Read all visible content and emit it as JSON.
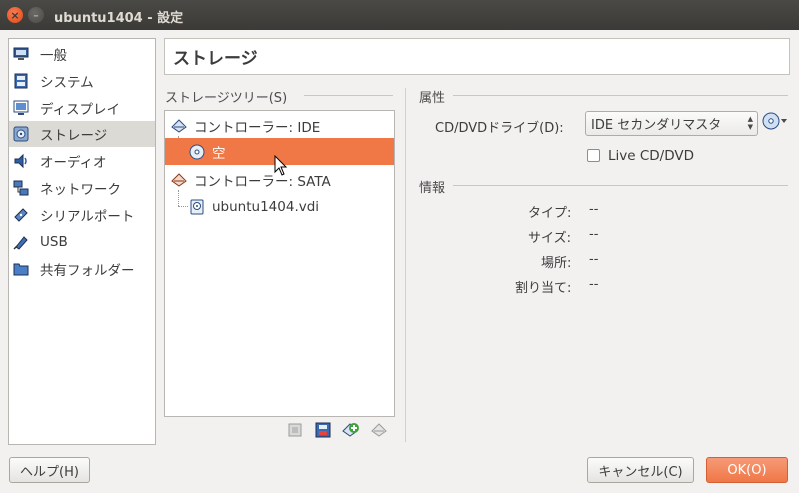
{
  "window": {
    "title": "ubuntu1404 - 設定",
    "close_glyph": "×",
    "min_glyph": "–"
  },
  "sidebar": {
    "items": [
      {
        "label": "一般",
        "icon": "general-monitor-icon"
      },
      {
        "label": "システム",
        "icon": "system-chip-icon"
      },
      {
        "label": "ディスプレイ",
        "icon": "display-monitor-icon"
      },
      {
        "label": "ストレージ",
        "icon": "storage-disk-icon",
        "selected": true
      },
      {
        "label": "オーディオ",
        "icon": "audio-speaker-icon"
      },
      {
        "label": "ネットワーク",
        "icon": "network-icon"
      },
      {
        "label": "シリアルポート",
        "icon": "serial-port-icon"
      },
      {
        "label": "USB",
        "icon": "usb-icon"
      },
      {
        "label": "共有フォルダー",
        "icon": "shared-folder-icon"
      }
    ]
  },
  "page_title": "ストレージ",
  "storage_tree": {
    "group_label": "ストレージツリー(S)",
    "rows": [
      {
        "label": "コントローラー: IDE",
        "icon": "ide-controller-icon"
      },
      {
        "label": "空",
        "icon": "optical-disc-icon",
        "selected": true
      },
      {
        "label": "コントローラー: SATA",
        "icon": "sata-controller-icon"
      },
      {
        "label": "ubuntu1404.vdi",
        "icon": "hard-disk-icon"
      }
    ],
    "tools": [
      "add-attachment-icon",
      "remove-attachment-icon",
      "add-controller-icon",
      "remove-controller-icon"
    ]
  },
  "attributes": {
    "group_label": "属性",
    "drive_label": "CD/DVDドライブ(D):",
    "drive_value": "IDE セカンダリマスタ",
    "live_cd_label": "Live CD/DVD",
    "live_cd_checked": false
  },
  "info": {
    "group_label": "情報",
    "rows": [
      {
        "label": "タイプ:",
        "value": "--"
      },
      {
        "label": "サイズ:",
        "value": "--"
      },
      {
        "label": "場所:",
        "value": "--"
      },
      {
        "label": "割り当て:",
        "value": "--"
      }
    ]
  },
  "buttons": {
    "help": "ヘルプ(H)",
    "cancel": "キャンセル(C)",
    "ok": "OK(O)"
  },
  "colors": {
    "selection": "#f07746",
    "titlebar": "#3b3a37",
    "accent_button": "#f07746"
  }
}
